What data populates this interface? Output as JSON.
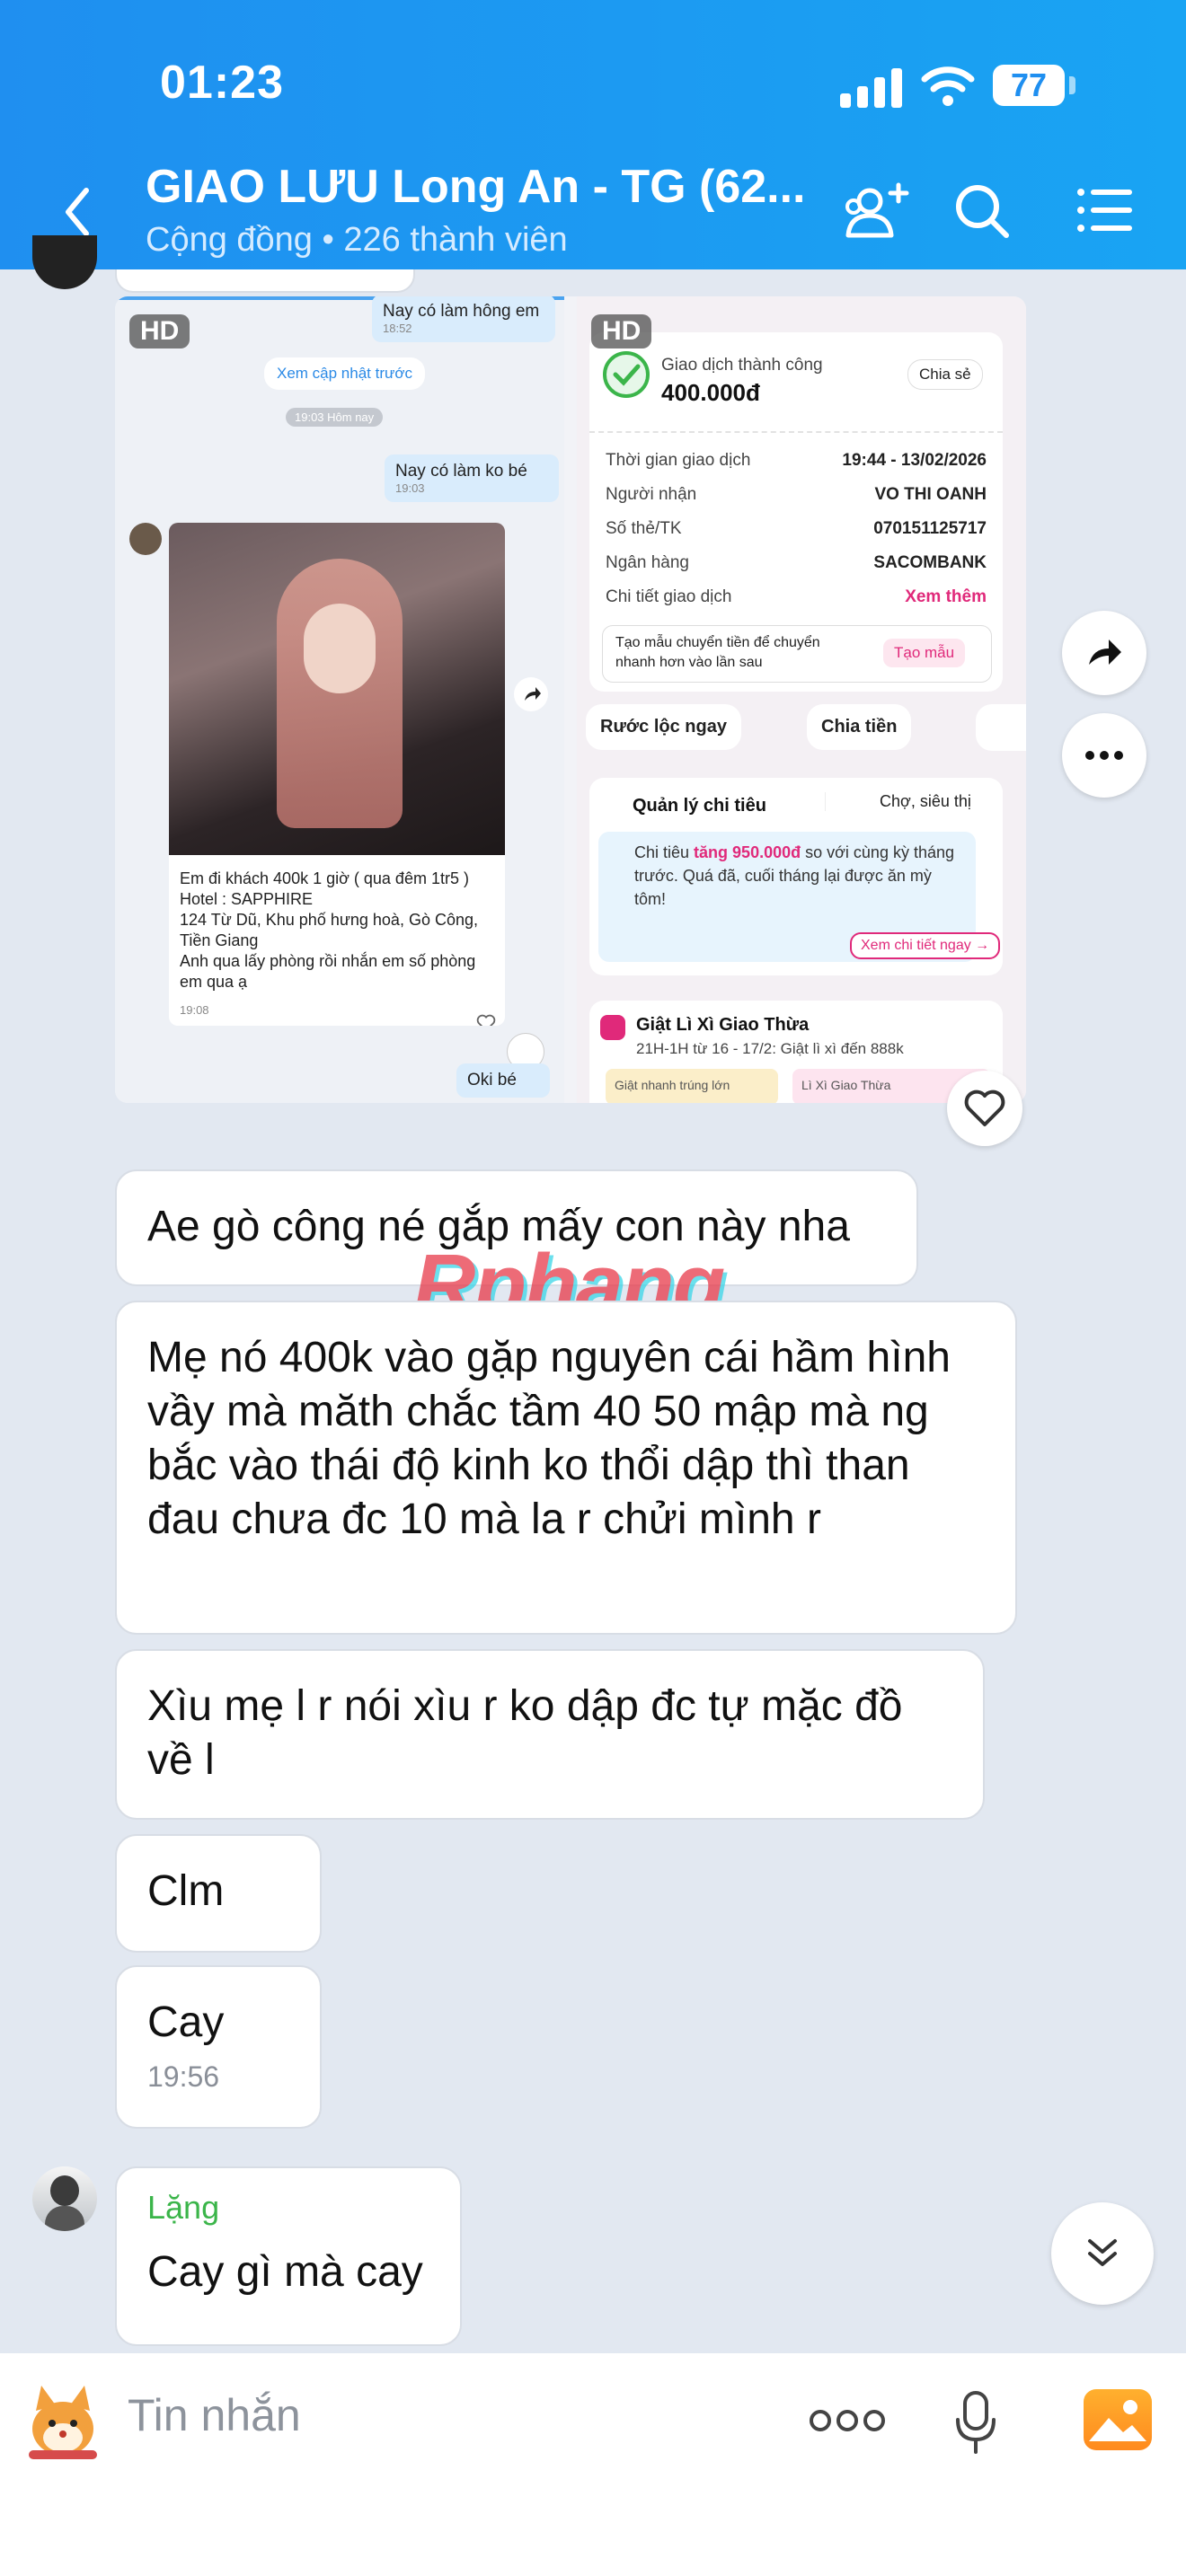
{
  "status": {
    "time": "01:23",
    "battery": "77"
  },
  "header": {
    "title": "GIAO LƯU Long An - TG (62...",
    "subtitle": "Cộng đồng • 226 thành viên"
  },
  "shared_image": {
    "hd_label": "HD",
    "left": {
      "top_msg": "Nay có làm hông em",
      "top_msg_time": "18:52",
      "update_link": "Xem cập nhật trước",
      "date_sep": "19:03 Hôm nay",
      "msg": "Nay có làm ko bé",
      "msg_time": "19:03",
      "caption": "Em đi khách 400k 1 giờ ( qua đêm 1tr5 )      Hotel : SAPPHIRE\n124 Từ Dũ, Khu phố hưng hoà, Gò Công, Tiền Giang\nAnh qua lấy phòng rồi nhắn em số phòng em qua ạ",
      "caption_time": "19:08",
      "reply": "Oki bé"
    },
    "right": {
      "success_title": "Giao dịch thành công",
      "amount": "400.000đ",
      "share_btn": "Chia sẻ",
      "rows": [
        {
          "label": "Thời gian giao dịch",
          "value": "19:44 - 13/02/2026"
        },
        {
          "label": "Người nhận",
          "value": "VO THI OANH"
        },
        {
          "label": "Số thẻ/TK",
          "value": "070151125717"
        },
        {
          "label": "Ngân hàng",
          "value": "SACOMBANK"
        },
        {
          "label": "Chi tiết giao dịch",
          "value": "Xem thêm"
        }
      ],
      "template_text": "Tạo mẫu chuyển tiền để chuyển nhanh hơn vào lần sau",
      "template_btn": "Tạo mẫu",
      "pills": [
        "Rước lộc ngay",
        "Chia tiền"
      ],
      "expense_title": "Quản lý chi tiêu",
      "expense_filter": "Chợ, siêu thị",
      "expense_text_pre": "Chi tiêu ",
      "expense_text_hl": "tăng 950.000đ",
      "expense_text_post": " so với cùng kỳ tháng trước. Quá đã, cuối tháng lại được ăn mỳ tôm!",
      "expense_btn": "Xem chi tiết ngay →",
      "lixi_title": "Giật Lì Xì Giao Thừa",
      "lixi_sub": "21H-1H từ 16 - 17/2: Giật lì xì đến 888k",
      "lixi_tag1": "Giật nhanh trúng lớn",
      "lixi_tag2": "Lì Xì Giao Thừa"
    }
  },
  "watermark": "Rphang",
  "messages": [
    {
      "text": "Ae gò công né gắp mấy con này nha"
    },
    {
      "text": "Mẹ nó 400k vào gặp nguyên cái hầm hình vầy mà măth chắc tầm 40 50 mập mà ng bắc vào thái độ kinh ko thổi dập thì than đau chưa đc 10 mà la r chửi mình r"
    },
    {
      "text": "Xìu mẹ l r nói xìu r ko dập đc tự mặc đồ về l"
    },
    {
      "text": "Clm"
    },
    {
      "text": "Cay",
      "time": "19:56"
    },
    {
      "sender": "Lặng",
      "text": "Cay gì mà cay"
    }
  ],
  "composer": {
    "placeholder": "Tin nhắn"
  },
  "colors": {
    "header": "#1f8ff0",
    "sender_name": "#3bb54a",
    "accent_pink": "#e0297a"
  }
}
